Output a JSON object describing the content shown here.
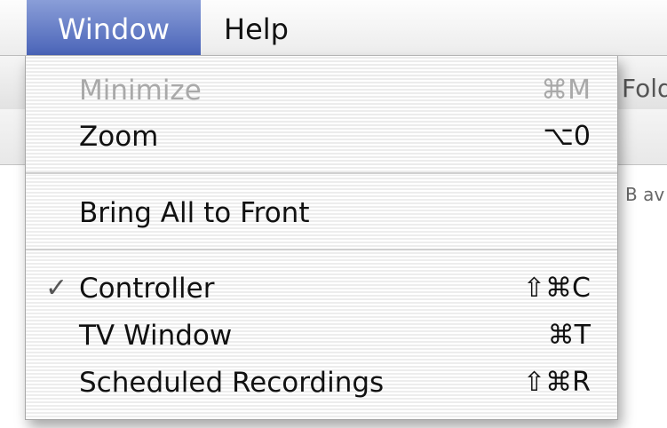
{
  "menubar": {
    "items": [
      {
        "label": "Window",
        "active": true
      },
      {
        "label": "Help",
        "active": false
      }
    ],
    "active_color": "#5a72c4"
  },
  "background_window": {
    "toolbar_text": "Fold",
    "status_text": "B av"
  },
  "window_menu": {
    "items": [
      {
        "label": "Minimize",
        "shortcut": "⌘M",
        "enabled": false,
        "checked": false,
        "check_glyph": ""
      },
      {
        "label": "Zoom",
        "shortcut": "⌥0",
        "enabled": true,
        "checked": false,
        "check_glyph": ""
      },
      {
        "label": "Bring All to Front",
        "shortcut": "",
        "enabled": true,
        "checked": false,
        "check_glyph": ""
      },
      {
        "label": "Controller",
        "shortcut": "⇧⌘C",
        "enabled": true,
        "checked": true,
        "check_glyph": "✓"
      },
      {
        "label": "TV Window",
        "shortcut": "⌘T",
        "enabled": true,
        "checked": false,
        "check_glyph": ""
      },
      {
        "label": "Scheduled Recordings",
        "shortcut": "⇧⌘R",
        "enabled": true,
        "checked": false,
        "check_glyph": ""
      }
    ]
  }
}
